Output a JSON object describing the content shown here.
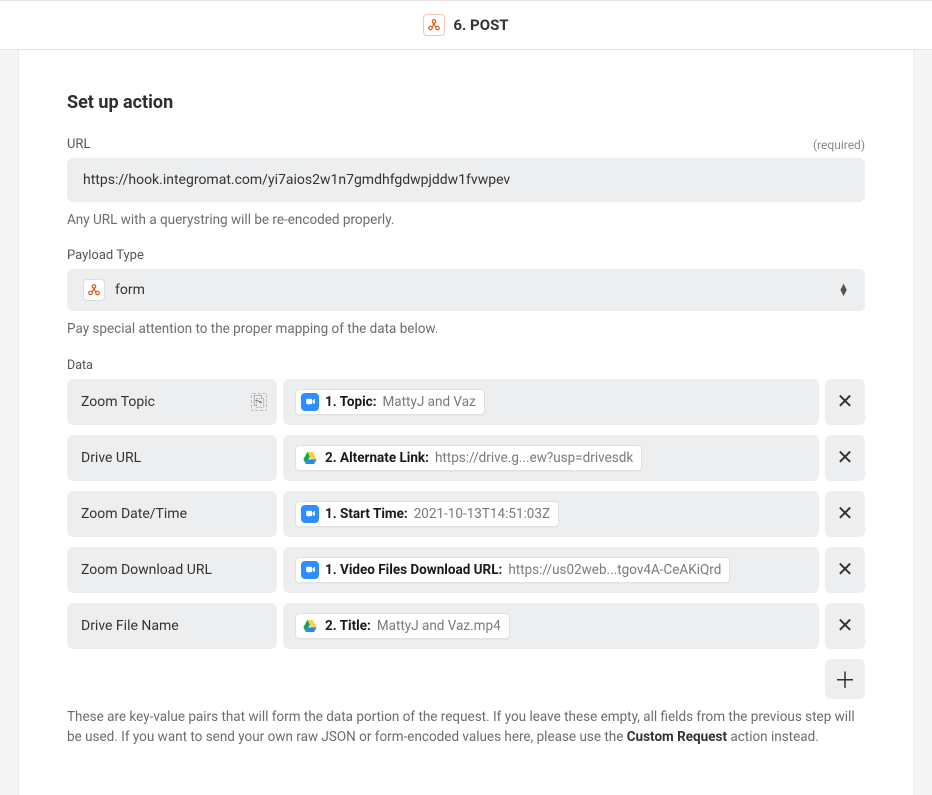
{
  "header": {
    "step_label": "6. POST"
  },
  "section": {
    "title": "Set up action"
  },
  "url_field": {
    "label": "URL",
    "required": "(required)",
    "value": "https://hook.integromat.com/yi7aios2w1n7gmdhfgdwpjddw1fvwpev",
    "help": "Any URL with a querystring will be re-encoded properly."
  },
  "payload_field": {
    "label": "Payload Type",
    "value": "form",
    "help": "Pay special attention to the proper mapping of the data below."
  },
  "data_section": {
    "label": "Data",
    "rows": [
      {
        "key": "Zoom Topic",
        "icon": "zoom",
        "pill_label": "1. Topic:",
        "pill_value": "MattyJ and Vaz",
        "key_icon": true
      },
      {
        "key": "Drive URL",
        "icon": "drive",
        "pill_label": "2. Alternate Link:",
        "pill_value": "https://drive.g...ew?usp=drivesdk"
      },
      {
        "key": "Zoom Date/Time",
        "icon": "zoom",
        "pill_label": "1. Start Time:",
        "pill_value": "2021-10-13T14:51:03Z"
      },
      {
        "key": "Zoom Download URL",
        "icon": "zoom",
        "pill_label": "1. Video Files Download URL:",
        "pill_value": "https://us02web...tgov4A-CeAKiQrd"
      },
      {
        "key": "Drive File Name",
        "icon": "drive",
        "pill_label": "2. Title:",
        "pill_value": "MattyJ and Vaz.mp4"
      }
    ],
    "help_prefix": "These are key-value pairs that will form the data portion of the request. If you leave these empty, all fields from the previous step will be used. If you want to send your own raw JSON or form-encoded values here, please use the ",
    "help_strong": "Custom Request",
    "help_suffix": " action instead."
  }
}
